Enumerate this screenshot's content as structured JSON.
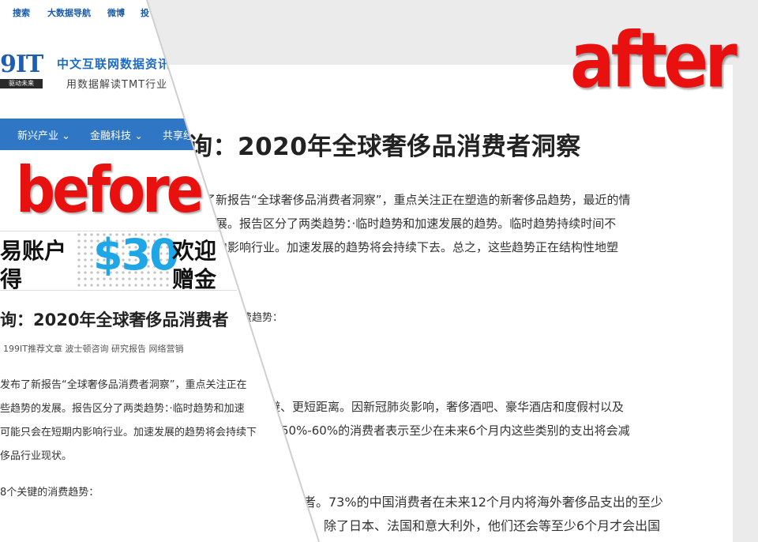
{
  "labels": {
    "after": "after",
    "before": "before"
  },
  "after": {
    "title": "询：2020年全球奢侈品消费者洞察",
    "paragraph1": [
      "了新报告“全球奢侈品消费者洞察”，重点关注正在塑造的新奢侈品趋势，最近的情",
      "发展。报告区分了两类趋势：·临时趋势和加速发展的趋势。临时趋势持续时间不",
      "期内影响行业。加速发展的趋势将会持续下去。总之，这些趋势正在结构性地塑"
    ],
    "trends_heading": "费趋势：",
    "paragraph2": [
      "避、更短距离。因新冠肺炎影响，奢侈酒吧、豪华酒店和度假村以及",
      "50%-60%的消费者表示至少在未来6个月内这些类别的支出将会减"
    ],
    "paragraph3": [
      "者。73%的中国消费者在未来12个月内将海外奢侈品支出的至少",
      "，除了日本、法国和意大利外，他们还会等至少6个月才会出国"
    ]
  },
  "before": {
    "top_nav": [
      "搜索",
      "大数据导航",
      "微博",
      "投"
    ],
    "logo": {
      "number": "9IT",
      "sub": "驱动未来"
    },
    "site_name": "中文互联网数据资讯",
    "site_slogan": "用数据解读TMT行业",
    "nav_items": [
      "新兴产业 ⌄",
      "金融科技 ⌄",
      "共享经"
    ],
    "ad": {
      "line1": "易账户",
      "line2": "得",
      "amount": "$30",
      "right1": "欢迎",
      "right2": "赠金"
    },
    "title": "询：2020年全球奢侈品消费者",
    "tags": "199IT推荐文章   波士顿咨询   研究报告   网络营销",
    "paragraph1": [
      "发布了新报告“全球奢侈品消费者洞察”，重点关注正在",
      "些趋势的发展。报告区分了两类趋势：·临时趋势和加速",
      "可能只会在短期内影响行业。加速发展的趋势将会持续下",
      "侈品行业现状。"
    ],
    "trends_heading": "8个关键的消费趋势："
  }
}
